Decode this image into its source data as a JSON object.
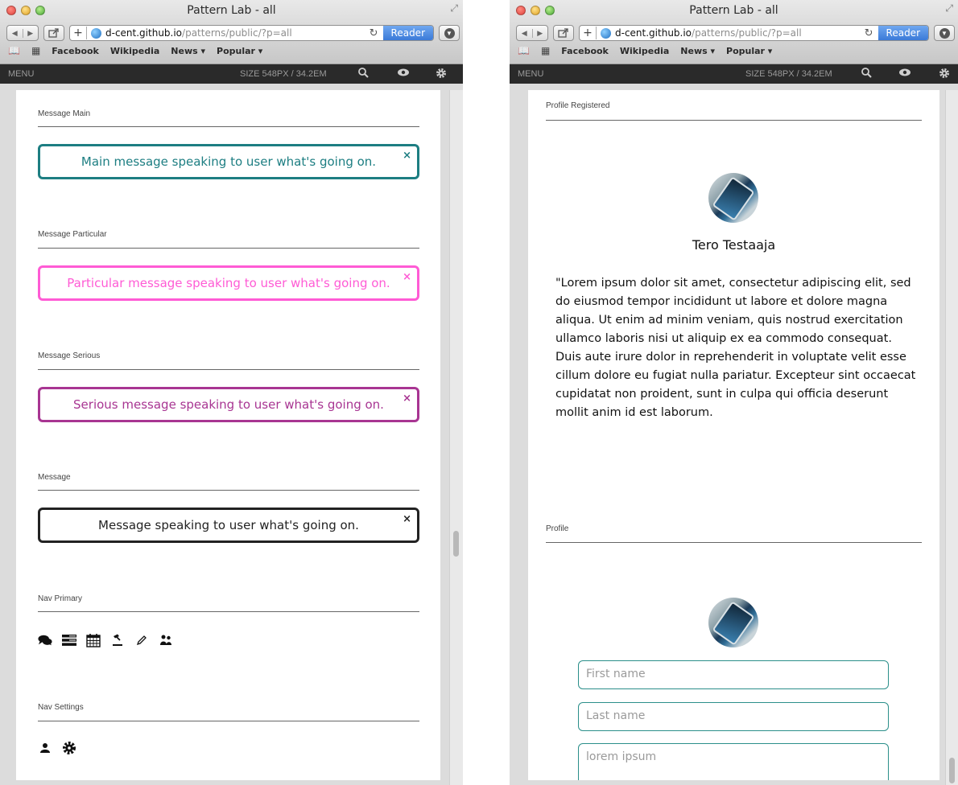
{
  "browser": {
    "title": "Pattern Lab - all",
    "url_host": "d-cent.github.io",
    "url_path": "/patterns/public/?p=all",
    "reader_label": "Reader",
    "bookmarks": [
      "Facebook",
      "Wikipedia",
      "News ▾",
      "Popular ▾"
    ],
    "plus": "+",
    "newtab": "+"
  },
  "patternlab": {
    "menu_label": "MENU",
    "size_label": "SIZE 548PX / 34.2EM"
  },
  "left_page": {
    "sections": [
      {
        "title": "Message Main",
        "message": "Main message speaking to user what's going on.",
        "color": "#1d7e82"
      },
      {
        "title": "Message Particular",
        "message": "Particular message speaking to user what's going on.",
        "color": "#ff5bd5"
      },
      {
        "title": "Message Serious",
        "message": "Serious message speaking to user what's going on.",
        "color": "#a83592"
      },
      {
        "title": "Message",
        "message": "Message speaking to user what's going on.",
        "color": "#222222"
      }
    ],
    "close_glyph": "×",
    "nav_primary_title": "Nav Primary",
    "nav_primary_icons": [
      "chat-icon",
      "list-icon",
      "calendar-icon",
      "gavel-icon",
      "pencil-icon",
      "people-icon"
    ],
    "nav_settings_title": "Nav Settings",
    "nav_settings_icons": [
      "user-icon",
      "gear-icon"
    ]
  },
  "right_page": {
    "profile_registered_title": "Profile Registered",
    "name": "Tero Testaaja",
    "quote": "\"Lorem ipsum dolor sit amet, consectetur adipiscing elit, sed do eiusmod tempor incididunt ut labore et dolore magna aliqua. Ut enim ad minim veniam, quis nostrud exercitation ullamco laboris nisi ut aliquip ex ea commodo consequat. Duis aute irure dolor in reprehenderit in voluptate velit esse cillum dolore eu fugiat nulla pariatur. Excepteur sint occaecat cupidatat non proident, sunt in culpa qui officia deserunt mollit anim id est laborum.",
    "profile_title": "Profile",
    "fields": {
      "first_name": "First name",
      "last_name": "Last name",
      "bio": "lorem ipsum"
    }
  },
  "colors": {
    "teal": "#1d7e82",
    "pink": "#ff5bd5",
    "purple": "#a83592",
    "dark": "#222222",
    "field_border": "#2b8f8a"
  }
}
